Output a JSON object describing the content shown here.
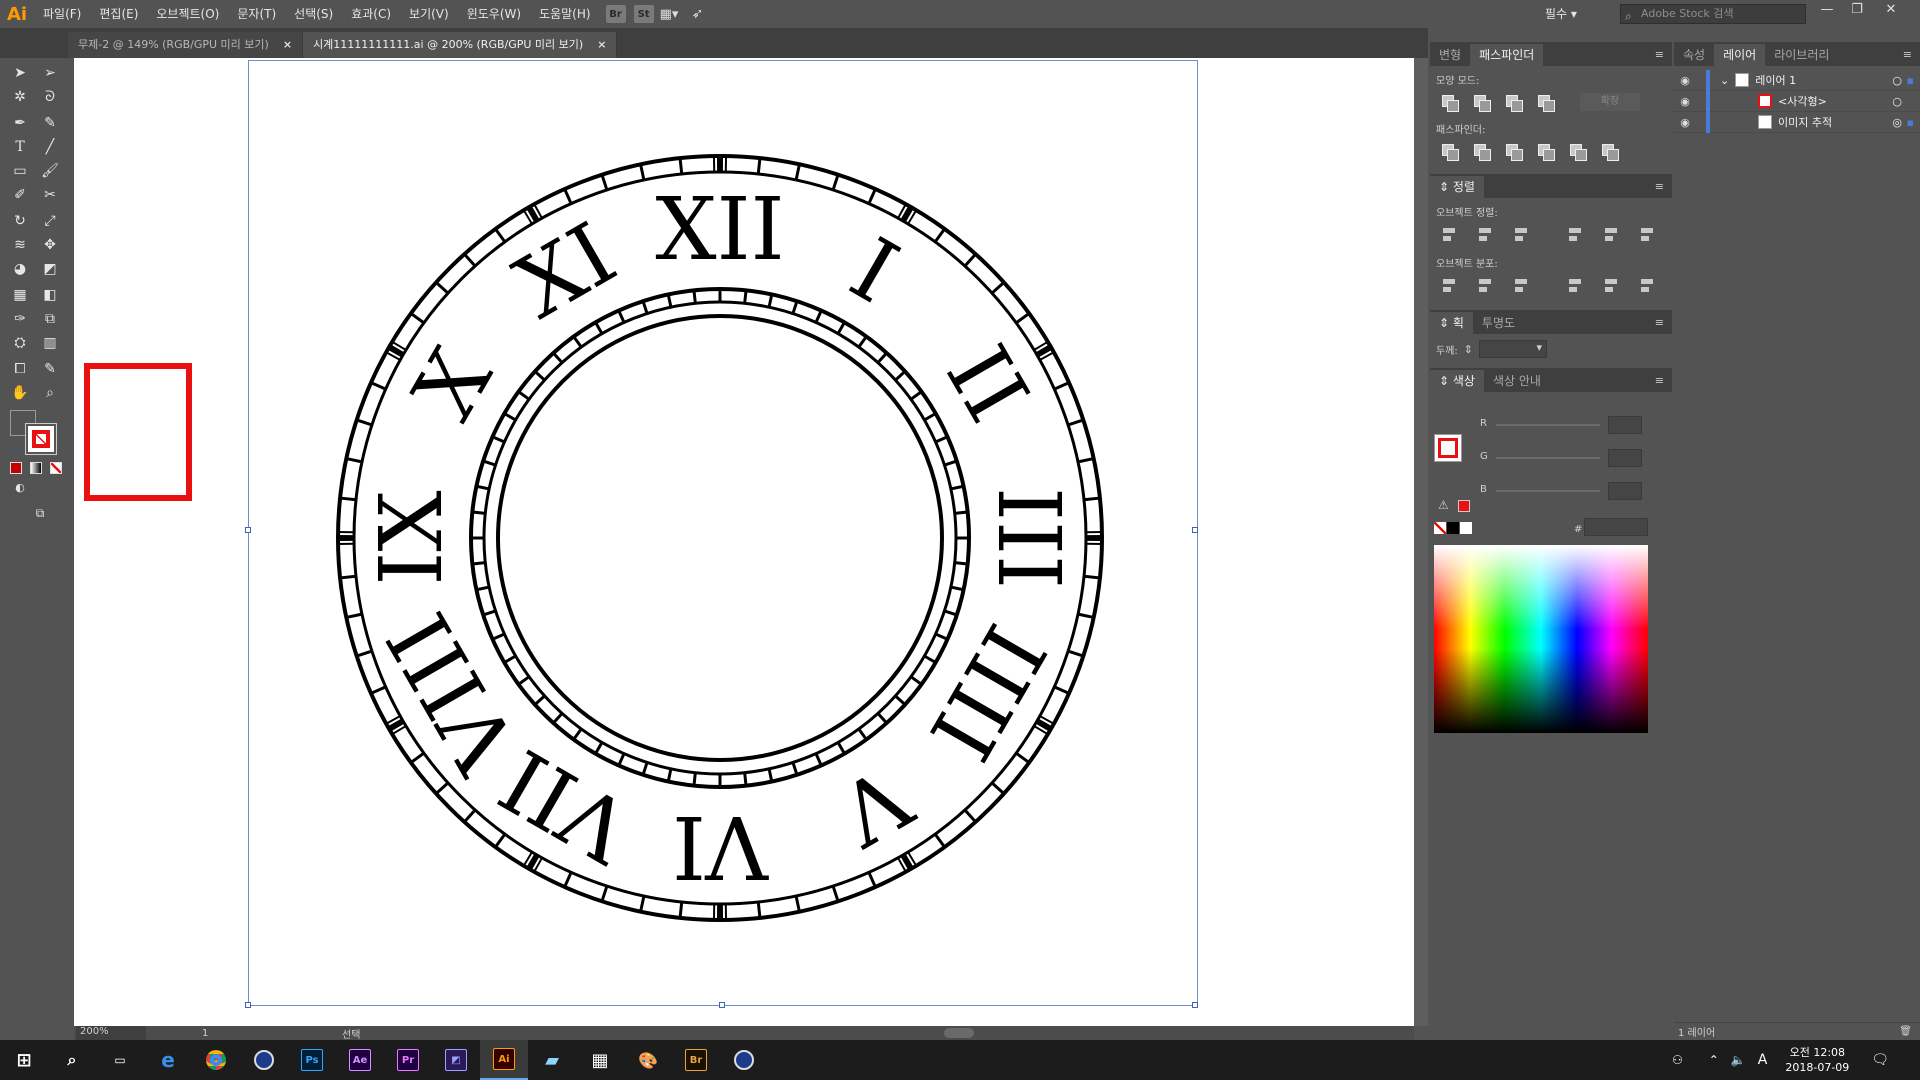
{
  "menubar": {
    "logo": "Ai",
    "items": [
      "파일(F)",
      "편집(E)",
      "오브젝트(O)",
      "문자(T)",
      "선택(S)",
      "효과(C)",
      "보기(V)",
      "윈도우(W)",
      "도움말(H)"
    ],
    "bridge_icon": "Br",
    "stock_icon": "St",
    "workspace": "필수",
    "search_placeholder": "Adobe Stock 검색"
  },
  "tabs": [
    {
      "label": "무제-2 @ 149% (RGB/GPU 미리 보기)",
      "close": "×"
    },
    {
      "label": "시계11111111111.ai @ 200% (RGB/GPU 미리 보기)",
      "close": "×"
    }
  ],
  "clock": {
    "numerals": [
      "XII",
      "I",
      "II",
      "III",
      "IIII",
      "V",
      "VI",
      "VII",
      "VIII",
      "IX",
      "X",
      "XI"
    ]
  },
  "status": {
    "zoom": "200%",
    "artboard": "1",
    "tool": "선택"
  },
  "pathfinder": {
    "tabs": [
      "변형",
      "패스파인더"
    ],
    "shape_modes": "모양 모드:",
    "expand": "확장",
    "pathfinders": "패스파인더:"
  },
  "align": {
    "title": "정렬",
    "align_objects": "오브젝트 정렬:",
    "distribute": "오브젝트 분포:"
  },
  "stroke": {
    "tabs": [
      "획",
      "투명도"
    ],
    "weight_label": "두께:"
  },
  "color": {
    "tabs": [
      "색상",
      "색상 안내"
    ],
    "r": "R",
    "g": "G",
    "b": "B",
    "hash": "#",
    "fill_color": "#e81010"
  },
  "rightpanel": {
    "tabs": [
      "속성",
      "레이어",
      "라이브러리"
    ],
    "layers": [
      "레이어 1",
      "<사각형>",
      "이미지 추적"
    ],
    "footer": "1 레이어"
  },
  "taskbar": {
    "apps": [
      "Ps",
      "Ae",
      "Pr",
      "Ai",
      "Br"
    ],
    "time": "오전 12:08",
    "date": "2018-07-09",
    "lang": "A"
  }
}
